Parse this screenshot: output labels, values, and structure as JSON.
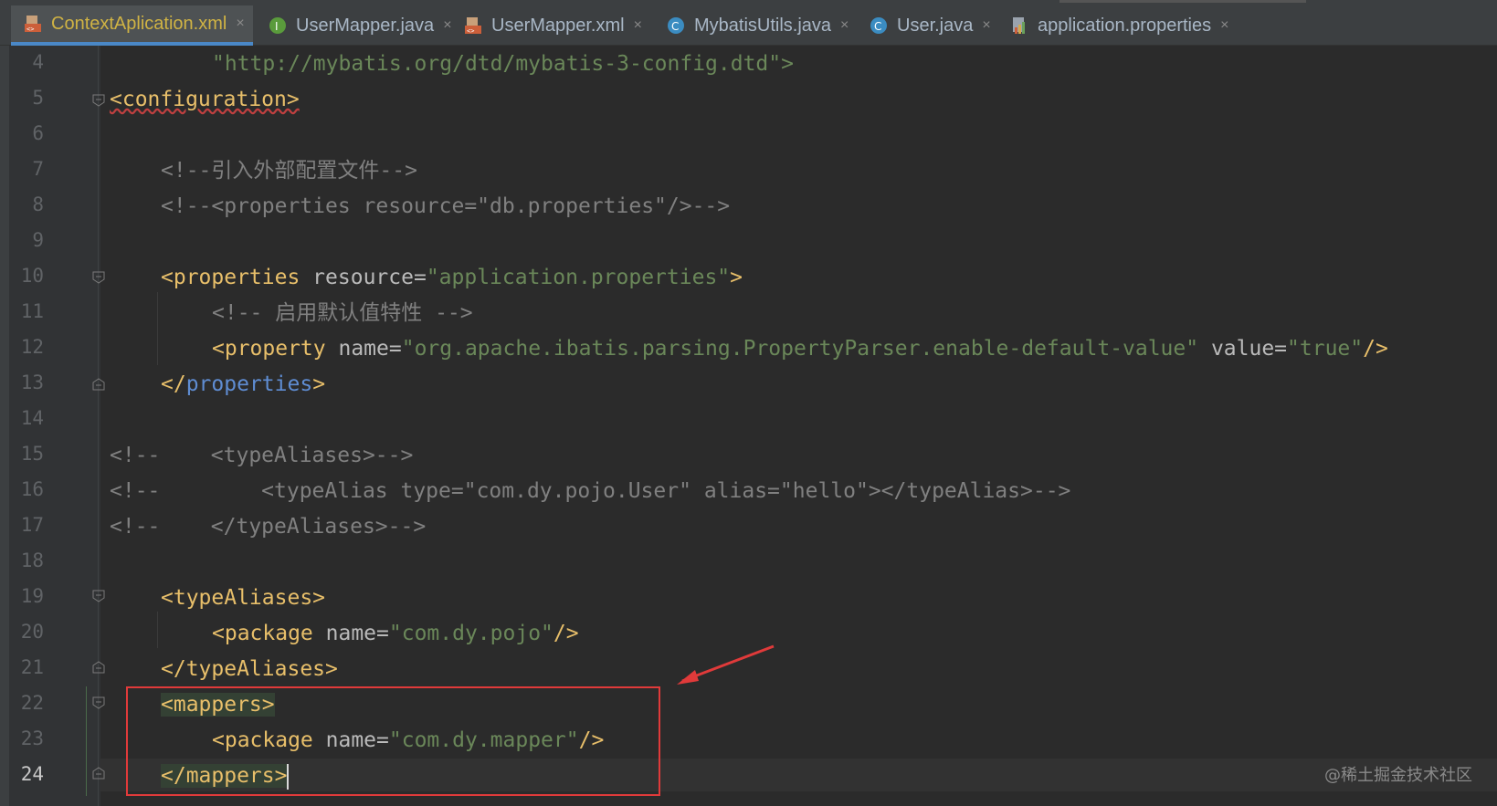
{
  "tabs": [
    {
      "label": "ContextAplication.xml",
      "icon": "xml-file-icon",
      "active": true
    },
    {
      "label": "UserMapper.java",
      "icon": "interface-file-icon"
    },
    {
      "label": "UserMapper.xml",
      "icon": "xml-file-icon"
    },
    {
      "label": "MybatisUtils.java",
      "icon": "class-file-icon"
    },
    {
      "label": "User.java",
      "icon": "class-file-icon"
    },
    {
      "label": "application.properties",
      "icon": "properties-file-icon"
    }
  ],
  "close_glyph": "×",
  "line_numbers": [
    "4",
    "5",
    "6",
    "7",
    "8",
    "9",
    "10",
    "11",
    "12",
    "13",
    "14",
    "15",
    "16",
    "17",
    "18",
    "19",
    "20",
    "21",
    "22",
    "23",
    "24"
  ],
  "code": {
    "l4": "\"http://mybatis.org/dtd/mybatis-3-config.dtd\">",
    "l5_tag": "<configuration>",
    "l7": "<!--引入外部配置文件-->",
    "l8": "<!--<properties resource=\"db.properties\"/>-->",
    "l10_tag": "<properties",
    "l10_attr": " resource=",
    "l10_val": "\"application.properties\"",
    "l10_end": ">",
    "l11": "<!-- 启用默认值特性 -->",
    "l12_tag": "<property",
    "l12_attr1": " name=",
    "l12_val1": "\"org.apache.ibatis.parsing.PropertyParser.enable-default-value\"",
    "l12_attr2": " value=",
    "l12_val2": "\"true\"",
    "l12_end": "/>",
    "l13_open": "</",
    "l13_name": "properties",
    "l13_close": ">",
    "l15": "<!--    <typeAliases>-->",
    "l16": "<!--        <typeAlias type=\"com.dy.pojo.User\" alias=\"hello\"></typeAlias>-->",
    "l17": "<!--    </typeAliases>-->",
    "l19": "<typeAliases>",
    "l20_tag": "<package",
    "l20_attr": " name=",
    "l20_val": "\"com.dy.pojo\"",
    "l20_end": "/>",
    "l21": "</typeAliases>",
    "l22": "<mappers>",
    "l23_tag": "<package",
    "l23_attr": " name=",
    "l23_val": "\"com.dy.mapper\"",
    "l23_end": "/>",
    "l24": "</mappers>"
  },
  "watermark": "@稀土掘金技术社区",
  "colors": {
    "background": "#2b2b2b",
    "tag": "#e8bf6a",
    "string": "#6a8759",
    "comment": "#808080",
    "highlight_box": "#e03a3a"
  }
}
